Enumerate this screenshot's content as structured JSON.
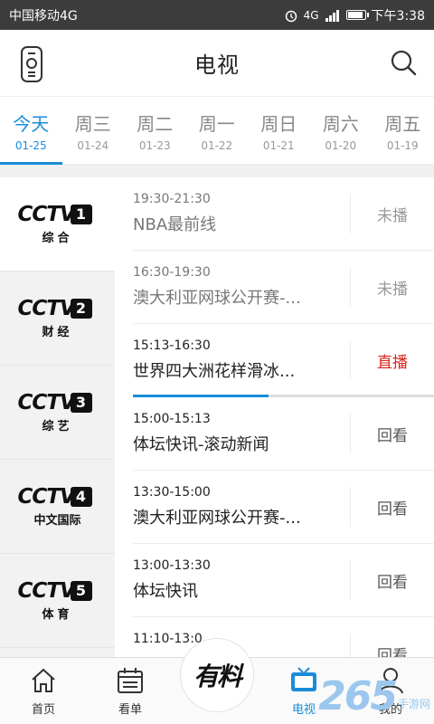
{
  "statusbar": {
    "carrier": "中国移动4G",
    "time": "下午3:38",
    "network": "4G",
    "battery_level": 0.9
  },
  "header": {
    "title": "电视",
    "left_icon": "remote-control-icon",
    "right_icon": "search-icon"
  },
  "days": [
    {
      "name": "今天",
      "date": "01-25",
      "active": true
    },
    {
      "name": "周三",
      "date": "01-24"
    },
    {
      "name": "周二",
      "date": "01-23"
    },
    {
      "name": "周一",
      "date": "01-22"
    },
    {
      "name": "周日",
      "date": "01-21"
    },
    {
      "name": "周六",
      "date": "01-20"
    },
    {
      "name": "周五",
      "date": "01-19"
    }
  ],
  "channels": [
    {
      "logo": "CCTV",
      "number": "1",
      "sub": "综合",
      "selected": true
    },
    {
      "logo": "CCTV",
      "number": "2",
      "sub": "财经"
    },
    {
      "logo": "CCTV",
      "number": "3",
      "sub": "综艺"
    },
    {
      "logo": "CCTV",
      "number": "4",
      "sub": "中文国际"
    },
    {
      "logo": "CCTV",
      "number": "5",
      "sub": "体育"
    }
  ],
  "programs": [
    {
      "time": "19:30-21:30",
      "title": "NBA最前线",
      "action": "未播",
      "state": "future"
    },
    {
      "time": "16:30-19:30",
      "title": "澳大利亚网球公开赛-...",
      "action": "未播",
      "state": "future"
    },
    {
      "time": "15:13-16:30",
      "title": "世界四大洲花样滑冰...",
      "action": "直播",
      "state": "live",
      "progress": 0.45
    },
    {
      "time": "15:00-15:13",
      "title": "体坛快讯-滚动新闻",
      "action": "回看",
      "state": "past"
    },
    {
      "time": "13:30-15:00",
      "title": "澳大利亚网球公开赛-...",
      "action": "回看",
      "state": "past"
    },
    {
      "time": "13:00-13:30",
      "title": "体坛快讯",
      "action": "回看",
      "state": "past"
    },
    {
      "time": "11:10-13:0",
      "title": "",
      "action": "回看",
      "state": "past"
    }
  ],
  "bottomnav": {
    "items": [
      {
        "label": "首页",
        "icon": "home-icon"
      },
      {
        "label": "看单",
        "icon": "calendar-icon"
      },
      {
        "label": "",
        "icon": "center-button"
      },
      {
        "label": "电视",
        "icon": "tv-icon",
        "active": true
      },
      {
        "label": "我的",
        "icon": "user-icon"
      }
    ],
    "center_label": "有料"
  },
  "watermark": {
    "number": "265",
    "text": "手游网"
  },
  "colors": {
    "accent": "#1a8cd8",
    "live": "#d9261c",
    "statusbar": "#3c3c3c"
  }
}
